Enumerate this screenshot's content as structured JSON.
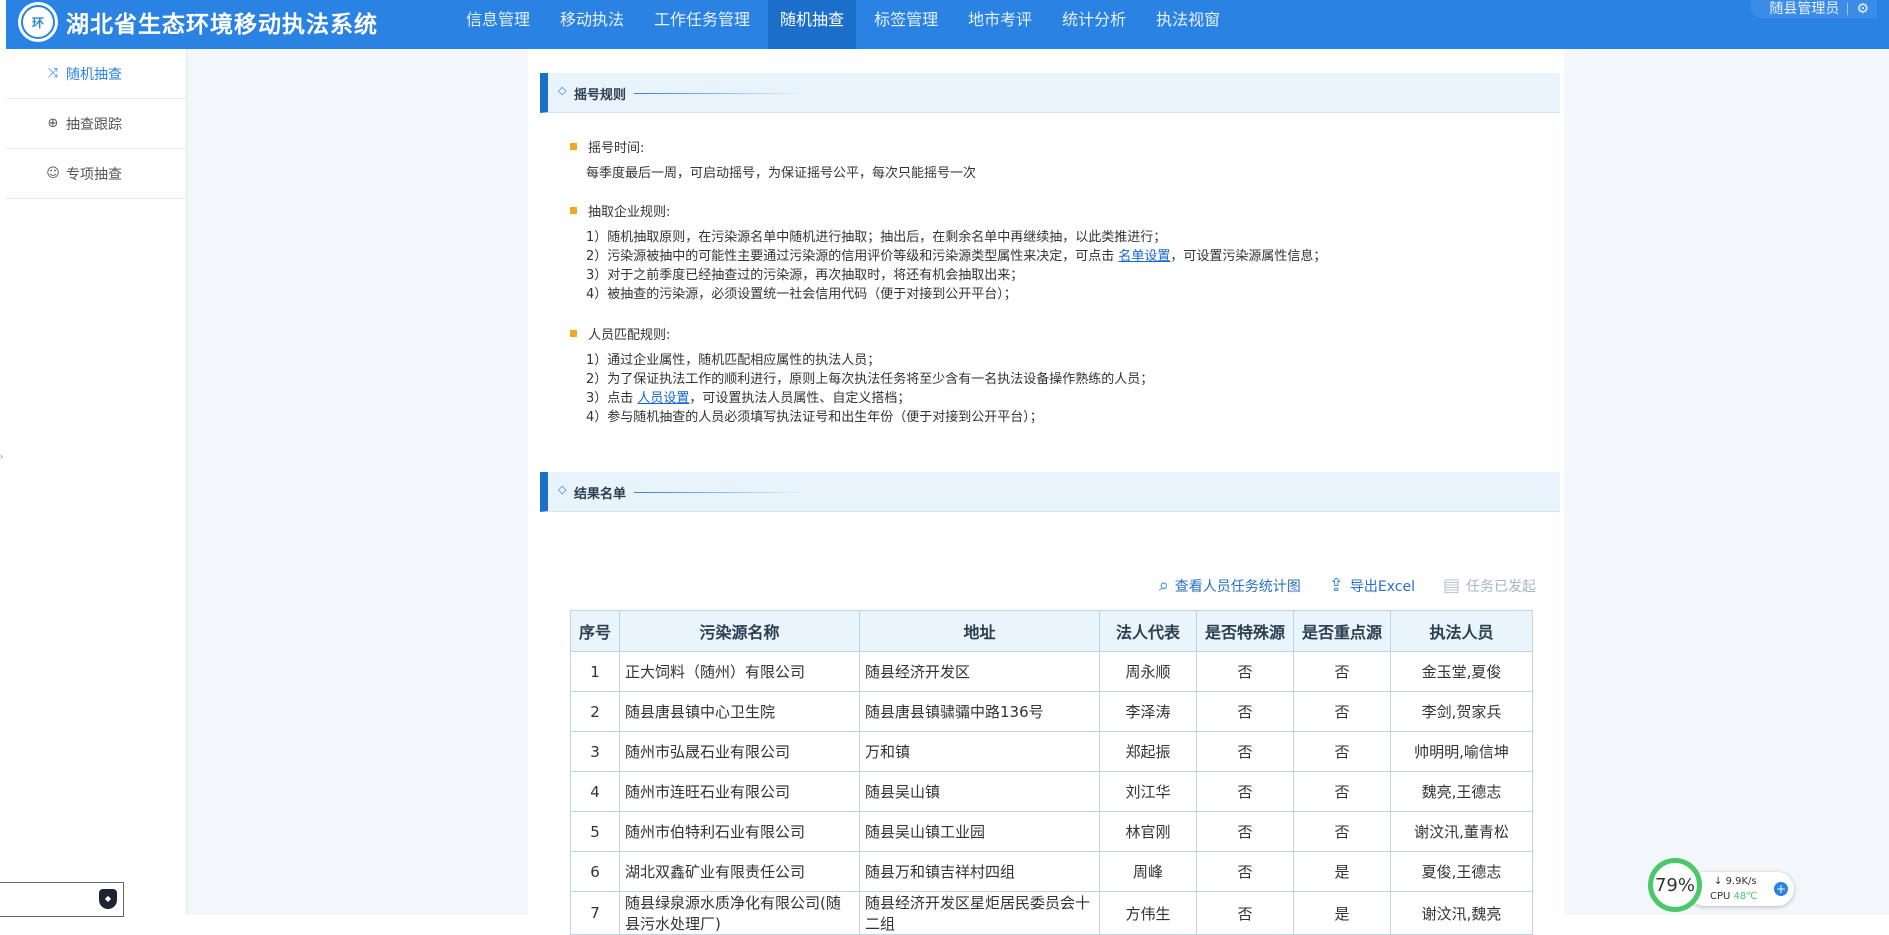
{
  "app": {
    "title": "湖北省生态环境移动执法系统",
    "logo_text": "环"
  },
  "nav": {
    "items": [
      "信息管理",
      "移动执法",
      "工作任务管理",
      "随机抽查",
      "标签管理",
      "地市考评",
      "统计分析",
      "执法视窗"
    ],
    "active": "随机抽查"
  },
  "user": {
    "name": "随县管理员",
    "gear_icon": "gear-icon"
  },
  "sidebar": {
    "items": [
      {
        "label": "随机抽查",
        "icon": "shuffle-icon"
      },
      {
        "label": "抽查跟踪",
        "icon": "target-icon"
      },
      {
        "label": "专项抽查",
        "icon": "inspector-icon"
      }
    ]
  },
  "rules_section": {
    "title": "摇号规则",
    "time": {
      "heading": "摇号时间:",
      "lines": [
        "每季度最后一周，可启动摇号，为保证摇号公平，每次只能摇号一次"
      ]
    },
    "company": {
      "heading": "抽取企业规则:",
      "line1": "1）随机抽取原则，在污染源名单中随机进行抽取；抽出后，在剩余名单中再继续抽，以此类推进行；",
      "line2_pre": "2）污染源被抽中的可能性主要通过污染源的信用评价等级和污染源类型属性来决定，可点击 ",
      "line2_link": "名单设置",
      "line2_post": "，可设置污染源属性信息；",
      "line3": "3）对于之前季度已经抽查过的污染源，再次抽取时，将还有机会抽取出来；",
      "line4": "4）被抽查的污染源，必须设置统一社会信用代码（便于对接到公开平台）；"
    },
    "personnel": {
      "heading": "人员匹配规则:",
      "line1": "1）通过企业属性，随机匹配相应属性的执法人员；",
      "line2": "2）为了保证执法工作的顺利进行，原则上每次执法任务将至少含有一名执法设备操作熟练的人员；",
      "line3_pre": "3）点击 ",
      "line3_link": "人员设置",
      "line3_post": "，可设置执法人员属性、自定义搭档；",
      "line4": "4）参与随机抽查的人员必须填写执法证号和出生年份（便于对接到公开平台）；"
    }
  },
  "results_section": {
    "title": "结果名单",
    "toolbar": {
      "view_stats": "查看人员任务统计图",
      "export": "导出Excel",
      "launched": "任务已发起"
    },
    "columns": [
      "序号",
      "污染源名称",
      "地址",
      "法人代表",
      "是否特殊源",
      "是否重点源",
      "执法人员"
    ],
    "rows": [
      [
        "1",
        "正大饲料（随州）有限公司",
        "随县经济开发区",
        "周永顺",
        "否",
        "否",
        "金玉堂,夏俊"
      ],
      [
        "2",
        "随县唐县镇中心卫生院",
        "随县唐县镇骕骦中路136号",
        "李泽涛",
        "否",
        "否",
        "李剑,贺家兵"
      ],
      [
        "3",
        "随州市弘晟石业有限公司",
        "万和镇",
        "郑起振",
        "否",
        "否",
        "帅明明,喻信坤"
      ],
      [
        "4",
        "随州市连旺石业有限公司",
        "随县吴山镇",
        "刘江华",
        "否",
        "否",
        "魏亮,王德志"
      ],
      [
        "5",
        "随州市伯特利石业有限公司",
        "随县吴山镇工业园",
        "林官刚",
        "否",
        "否",
        "谢汶汛,董青松"
      ],
      [
        "6",
        "湖北双鑫矿业有限责任公司",
        "随县万和镇吉祥村四组",
        "周峰",
        "否",
        "是",
        "夏俊,王德志"
      ],
      [
        "7",
        "随县绿泉源水质净化有限公司(随县污水处理厂)",
        "随县经济开发区星炬居民委员会十二组",
        "方伟生",
        "否",
        "是",
        "谢汶汛,魏亮"
      ]
    ]
  },
  "monitor": {
    "percent": "79%",
    "speed": "9.9K/s",
    "cpu_label": "CPU",
    "cpu_temp": "48℃",
    "accent": "#4cc76a"
  }
}
